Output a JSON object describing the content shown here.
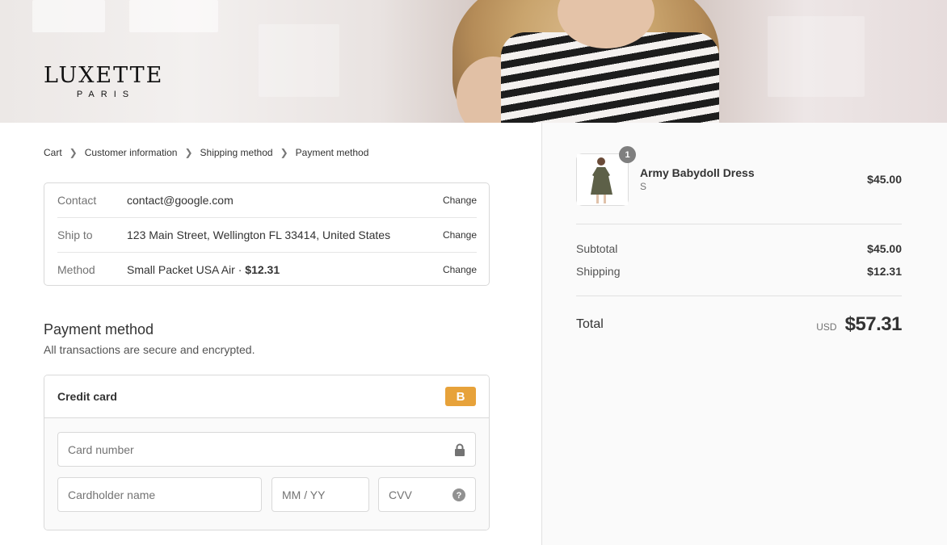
{
  "brand": {
    "name": "LUXETTE",
    "sub": "PARIS"
  },
  "breadcrumb": [
    "Cart",
    "Customer information",
    "Shipping method",
    "Payment method"
  ],
  "review": [
    {
      "label": "Contact",
      "value": "contact@google.com",
      "action": "Change"
    },
    {
      "label": "Ship to",
      "value": "123 Main Street, Wellington FL 33414, United States",
      "action": "Change"
    },
    {
      "label": "Method",
      "value_text": "Small Packet USA Air · ",
      "value_price": "$12.31",
      "action": "Change"
    }
  ],
  "payment": {
    "title": "Payment method",
    "subtitle": "All transactions are secure and encrypted.",
    "option_label": "Credit card",
    "badge": "B",
    "badge_color": "#e7a23a",
    "fields": {
      "card_number": "Card number",
      "cardholder": "Cardholder name",
      "expiry": "MM / YY",
      "cvv": "CVV"
    }
  },
  "order": {
    "item": {
      "name": "Army Babydoll Dress",
      "variant": "S",
      "price": "$45.00",
      "quantity": "1"
    },
    "subtotal_label": "Subtotal",
    "subtotal": "$45.00",
    "shipping_label": "Shipping",
    "shipping": "$12.31",
    "total_label": "Total",
    "currency": "USD",
    "total": "$57.31"
  }
}
